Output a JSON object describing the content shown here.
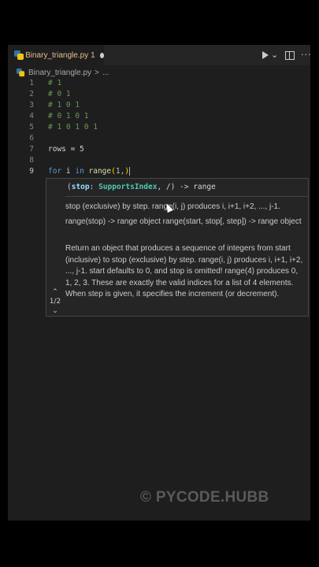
{
  "tab": {
    "filename": "Binary_triangle.py",
    "modified_count": "1"
  },
  "breadcrumb": {
    "file": "Binary_triangle.py",
    "separator": ">",
    "more": "..."
  },
  "toolbar": {
    "run_chevron": "⌄",
    "more": "···"
  },
  "code_lines": [
    {
      "num": "1",
      "text": "# 1"
    },
    {
      "num": "2",
      "text": "# 0 1"
    },
    {
      "num": "3",
      "text": "# 1 0 1"
    },
    {
      "num": "4",
      "text": "# 0 1 0 1"
    },
    {
      "num": "5",
      "text": "# 1 0 1 0 1"
    },
    {
      "num": "6",
      "text": ""
    },
    {
      "num": "7",
      "text": "rows = 5"
    },
    {
      "num": "8",
      "text": ""
    },
    {
      "num": "9",
      "kw_for": "for",
      "var_i": " i ",
      "kw_in": "in",
      "fn_range": " range",
      "open_paren": "(",
      "arg": "1,",
      "close_paren": ")"
    }
  ],
  "hover": {
    "sig_open": "(",
    "sig_param": "stop",
    "sig_colon": ": ",
    "sig_type": "SupportsIndex",
    "sig_rest": ", /) -> range",
    "doc1": "stop (exclusive) by step. range(i, j) produces i, i+1, i+2, ..., j-1.",
    "doc2": "range(stop) -> range object range(start, stop[, step]) -> range object",
    "doc3": "Return an object that produces a sequence of integers from start (inclusive) to stop (exclusive) by step. range(i, j) produces i, i+1, i+2, ..., j-1. start defaults to 0, and stop is omitted! range(4) produces 0, 1, 2, 3. These are exactly the valid indices for a list of 4 elements. When step is given, it specifies the increment (or decrement).",
    "nav_up": "⌃",
    "nav_count": "1/2",
    "nav_down": "⌄"
  },
  "watermark": "© PYCODE.HUBB"
}
